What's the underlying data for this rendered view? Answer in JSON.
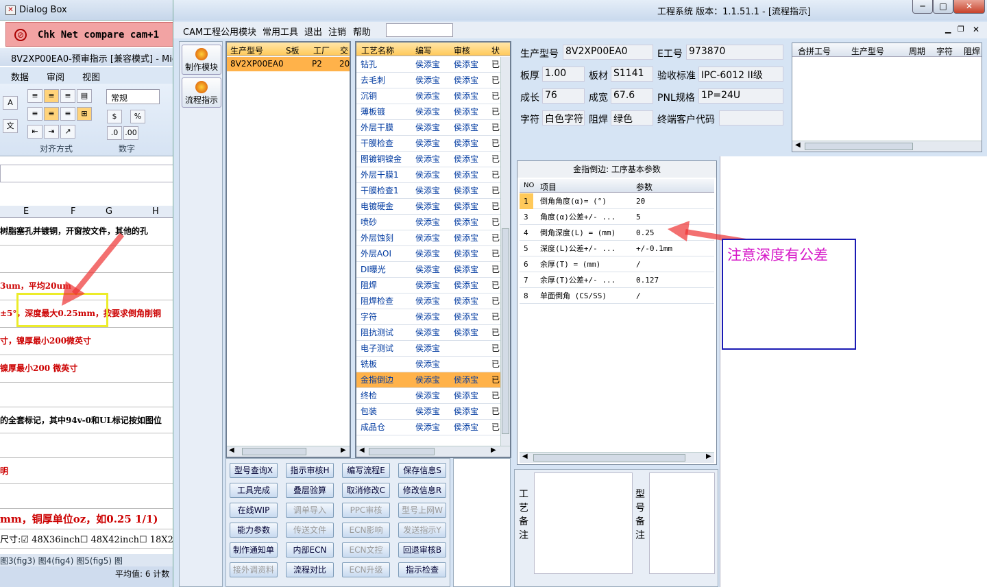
{
  "dialog": {
    "title": "Dialog Box",
    "message": "Chk Net compare cam+1"
  },
  "excel": {
    "title": "8V2XP00EA0-预审指示 [兼容模式] - Micro",
    "tabs": [
      "数据",
      "审阅",
      "视图"
    ],
    "number_format": "常规",
    "group_align": "对齐方式",
    "group_number": "数字",
    "columns": [
      "E",
      "F",
      "G",
      "H"
    ],
    "rows": [
      "树脂塞孔并镀铜，开窗按文件，其他的孔",
      "",
      "3um，平均20um",
      "±5°，深度最大0.25mm，按要求倒角削铜",
      "寸，镍厚最小200微英寸",
      "镍厚最小200 微英寸",
      "",
      "的全套标记，其中94v-0和UL标记按如图位",
      "",
      "明",
      "",
      "mm，铜厚单位oz，如0.25 1/1)",
      "尺寸:☑ 48X36inch☐ 48X42inch☐ 18X2"
    ],
    "sheet_tabs": "图3(fig3)  图4(fig4)  图5(fig5)  图",
    "status": "平均值: 6   计数"
  },
  "main": {
    "title": "工程系统  版本：1.1.51.1 - [流程指示]",
    "menu": [
      "CAM工程",
      "公用模块",
      "常用工具",
      "退出",
      "注销",
      "帮助"
    ],
    "side_buttons": [
      "制作模块",
      "流程指示"
    ],
    "model_grid": {
      "headers": [
        "生产型号",
        "S板",
        "工厂",
        "交"
      ],
      "rows": [
        [
          "8V2XP00EA0",
          "P2",
          "20"
        ]
      ]
    },
    "process_grid": {
      "headers": [
        "工艺名称",
        "编写",
        "审核",
        "状"
      ],
      "rows": [
        [
          "钻孔",
          "侯添宝",
          "侯添宝",
          "已"
        ],
        [
          "去毛刺",
          "侯添宝",
          "侯添宝",
          "已"
        ],
        [
          "沉铜",
          "侯添宝",
          "侯添宝",
          "已"
        ],
        [
          "薄板镀",
          "侯添宝",
          "侯添宝",
          "已"
        ],
        [
          "外层干膜",
          "侯添宝",
          "侯添宝",
          "已"
        ],
        [
          "干膜检查",
          "侯添宝",
          "侯添宝",
          "已"
        ],
        [
          "图镀铜镍金",
          "侯添宝",
          "侯添宝",
          "已"
        ],
        [
          "外层干膜1",
          "侯添宝",
          "侯添宝",
          "已"
        ],
        [
          "干膜检查1",
          "侯添宝",
          "侯添宝",
          "已"
        ],
        [
          "电镀硬金",
          "侯添宝",
          "侯添宝",
          "已"
        ],
        [
          "喷砂",
          "侯添宝",
          "侯添宝",
          "已"
        ],
        [
          "外层蚀刻",
          "侯添宝",
          "侯添宝",
          "已"
        ],
        [
          "外层AOI",
          "侯添宝",
          "侯添宝",
          "已"
        ],
        [
          "DI曝光",
          "侯添宝",
          "侯添宝",
          "已"
        ],
        [
          "阻焊",
          "侯添宝",
          "侯添宝",
          "已"
        ],
        [
          "阻焊检查",
          "侯添宝",
          "侯添宝",
          "已"
        ],
        [
          "字符",
          "侯添宝",
          "侯添宝",
          "已"
        ],
        [
          "阻抗测试",
          "侯添宝",
          "侯添宝",
          "已"
        ],
        [
          "电子测试",
          "侯添宝",
          "",
          "已"
        ],
        [
          "铣板",
          "侯添宝",
          "",
          "已"
        ],
        [
          "金指倒边",
          "侯添宝",
          "侯添宝",
          "已"
        ],
        [
          "终检",
          "侯添宝",
          "侯添宝",
          "已"
        ],
        [
          "包装",
          "侯添宝",
          "侯添宝",
          "已"
        ],
        [
          "成品仓",
          "侯添宝",
          "侯添宝",
          "已"
        ]
      ],
      "selected": "金指倒边"
    },
    "info": {
      "model_label": "生产型号",
      "model": "8V2XP00EA0",
      "e_label": "E工号",
      "e_no": "973870",
      "thick_label": "板厚",
      "thick": "1.00",
      "mat_label": "板材",
      "mat": "S1141",
      "std_label": "验收标准",
      "std": "IPC-6012 II级",
      "len_label": "成长",
      "len": "76",
      "wid_label": "成宽",
      "wid": "67.6",
      "pnl_label": "PNL规格",
      "pnl": "1P=24U",
      "char_label": "字符",
      "char": "白色字符",
      "mask_label": "阻焊",
      "mask": "绿色",
      "cust_label": "终端客户代码",
      "cust": ""
    },
    "merge_grid": {
      "headers": [
        "合拼工号",
        "生产型号",
        "周期",
        "字符",
        "阻焊"
      ]
    },
    "param_grid": {
      "title": "金指倒边: 工序基本参数",
      "headers": [
        "NO",
        "项目",
        "参数"
      ],
      "rows": [
        [
          "1",
          "倒角角度(α)=  (°)",
          "20"
        ],
        [
          "3",
          "角度(α)公差+/- ...",
          "5"
        ],
        [
          "4",
          "倒角深度(L) =  (mm)",
          "0.25"
        ],
        [
          "5",
          "深度(L)公差+/- ...",
          "+/-0.1mm"
        ],
        [
          "6",
          "余厚(T) =  (mm)",
          "/"
        ],
        [
          "7",
          "余厚(T)公差+/-  ...",
          "0.127"
        ],
        [
          "8",
          "单面倒角 (CS/SS)",
          "/"
        ]
      ]
    },
    "remark": {
      "process_label": "工艺备注",
      "model_label": "型号备注"
    },
    "buttons": [
      [
        "型号查询X",
        "指示审核H",
        "编写流程E",
        "保存信息S"
      ],
      [
        "工具完成",
        "叠层验算",
        "取消修改C",
        "修改信息R"
      ],
      [
        "在线WIP",
        "调单导入",
        "PPC审核",
        "型号上网W"
      ],
      [
        "能力参数",
        "传送文件",
        "ECN影响",
        "发送指示Y"
      ],
      [
        "制作通知单",
        "内部ECN",
        "ECN文控",
        "回退审核B"
      ],
      [
        "接外调资料",
        "流程对比",
        "ECN升级",
        "指示检查"
      ]
    ],
    "disabled_buttons": [
      "调单导入",
      "PPC审核",
      "型号上网W",
      "传送文件",
      "ECN影响",
      "发送指示Y",
      "ECN文控",
      "ECN升级",
      "接外调资料"
    ],
    "annotation": "注意深度有公差",
    "colors": {
      "accent_red": "#ee3333",
      "annotation_text": "#d617c8",
      "selected_row": "#ffb24a"
    }
  }
}
